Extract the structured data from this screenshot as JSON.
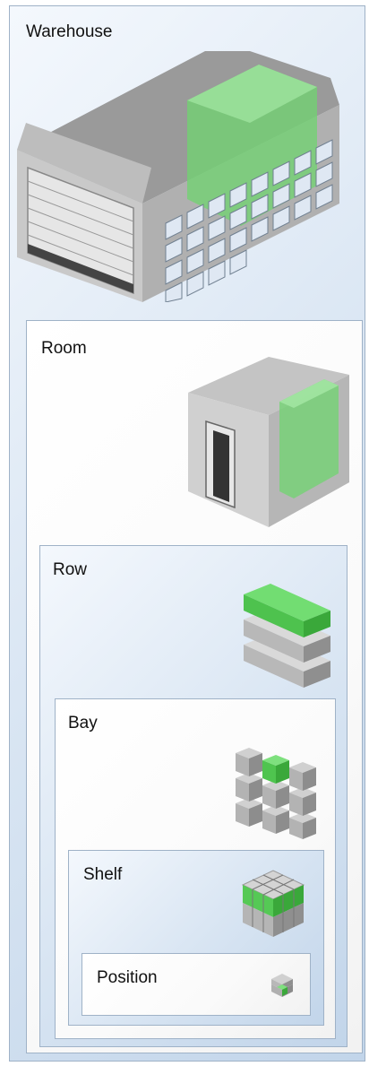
{
  "levels": {
    "warehouse": {
      "label": "Warehouse",
      "icon": "warehouse-icon"
    },
    "room": {
      "label": "Room",
      "icon": "room-icon"
    },
    "row": {
      "label": "Row",
      "icon": "row-icon"
    },
    "bay": {
      "label": "Bay",
      "icon": "bay-icon"
    },
    "shelf": {
      "label": "Shelf",
      "icon": "shelf-icon"
    },
    "position": {
      "label": "Position",
      "icon": "position-icon"
    }
  },
  "colors": {
    "highlight": "#5ccc5c",
    "panel_blue": "#d7e4f2",
    "border": "#9fb2c7",
    "cube_gray": "#a9a9a9"
  }
}
